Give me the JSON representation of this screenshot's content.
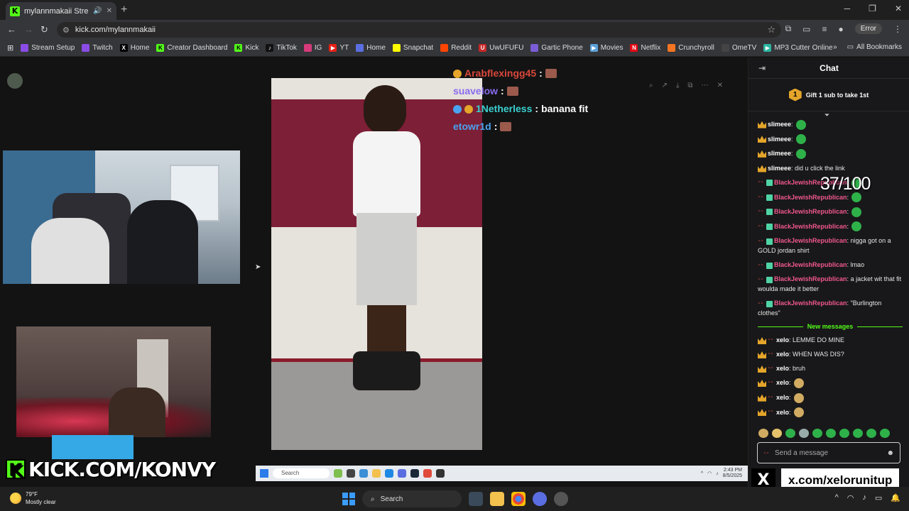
{
  "browser": {
    "tab_title": "mylannmakaii Stream - Wa",
    "url": "kick.com/mylannmakaii",
    "error_label": "Error",
    "bookmarks": [
      "Stream Setup",
      "Twitch",
      "Home",
      "Creator Dashboard",
      "Kick",
      "TikTok",
      "IG",
      "YT",
      "Home",
      "Snapchat",
      "Reddit",
      "UwUFUFU",
      "Gartic Phone",
      "Movies",
      "Netflix",
      "Crunchyroll",
      "OmeTV",
      "MP3 Cutter Online..."
    ],
    "all_bookmarks": "All Bookmarks"
  },
  "overlay": {
    "kick_url": "KICK.COM/KONVY",
    "x_url": "x.com/xelorunitup",
    "counter": "37/100"
  },
  "floating_chat": [
    {
      "user": "Arabflexingg45",
      "sep": ":",
      "text": "",
      "color": "#d9483b"
    },
    {
      "user": "suavelow",
      "sep": ":",
      "text": "",
      "color": "#8a6cf0"
    },
    {
      "user": "1Netherless",
      "sep": ":",
      "text": "banana fit",
      "color": "#3ad0d0"
    },
    {
      "user": "etowr1d",
      "sep": ":",
      "text": "",
      "color": "#4aa3f0"
    }
  ],
  "inner_taskbar": {
    "search": "Search",
    "time": "2:43 PM",
    "date": "8/5/2025"
  },
  "chat": {
    "title": "Chat",
    "gift_count": "1",
    "gift_text": "Gift 1 sub to take 1st",
    "new_messages": "New messages",
    "input_placeholder": "Send a message",
    "messages_before": [
      {
        "user": "slimeee",
        "text": "",
        "emote": "green",
        "color": "#ffffff",
        "type": "crown"
      },
      {
        "user": "slimeee",
        "text": "",
        "emote": "green",
        "color": "#ffffff",
        "type": "crown"
      },
      {
        "user": "slimeee",
        "text": "",
        "emote": "green",
        "color": "#ffffff",
        "type": "crown"
      },
      {
        "user": "slimeee",
        "text": " did u click the link",
        "emote": "",
        "color": "#ffffff",
        "type": "crown"
      },
      {
        "user": "BlackJewishRepublican",
        "text": "",
        "emote": "green",
        "color": "#f0578b",
        "type": "gift"
      },
      {
        "user": "BlackJewishRepublican",
        "text": "",
        "emote": "green",
        "color": "#f0578b",
        "type": "gift"
      },
      {
        "user": "BlackJewishRepublican",
        "text": "",
        "emote": "green",
        "color": "#f0578b",
        "type": "gift"
      },
      {
        "user": "BlackJewishRepublican",
        "text": "",
        "emote": "green",
        "color": "#f0578b",
        "type": "gift"
      },
      {
        "user": "BlackJewishRepublican",
        "text": " nigga got on a GOLD jordan shirt",
        "emote": "",
        "color": "#f0578b",
        "type": "gift"
      },
      {
        "user": "BlackJewishRepublican",
        "text": " lmao",
        "emote": "",
        "color": "#f0578b",
        "type": "gift"
      },
      {
        "user": "BlackJewishRepublican",
        "text": " a jacket wit that fit woulda made it better",
        "emote": "",
        "color": "#f0578b",
        "type": "gift"
      },
      {
        "user": "BlackJewishRepublican",
        "text": " \"Burlington clothes\"",
        "emote": "",
        "color": "#f0578b",
        "type": "gift"
      }
    ],
    "messages_after": [
      {
        "user": "xelo",
        "text": " LEMME DO MINE",
        "emote": "",
        "color": "#ffffff",
        "type": "crown"
      },
      {
        "user": "xelo",
        "text": " WHEN WAS DIS?",
        "emote": "",
        "color": "#ffffff",
        "type": "crown"
      },
      {
        "user": "xelo",
        "text": " bruh",
        "emote": "",
        "color": "#ffffff",
        "type": "crown"
      },
      {
        "user": "xelo",
        "text": "",
        "emote": "cookie",
        "color": "#ffffff",
        "type": "crown"
      },
      {
        "user": "xelo",
        "text": "",
        "emote": "cookie",
        "color": "#ffffff",
        "type": "crown"
      },
      {
        "user": "xelo",
        "text": "",
        "emote": "cookie",
        "color": "#ffffff",
        "type": "crown"
      }
    ]
  },
  "weather": {
    "temp": "79°F",
    "condition": "Mostly clear"
  },
  "taskbar": {
    "search": "Search"
  }
}
